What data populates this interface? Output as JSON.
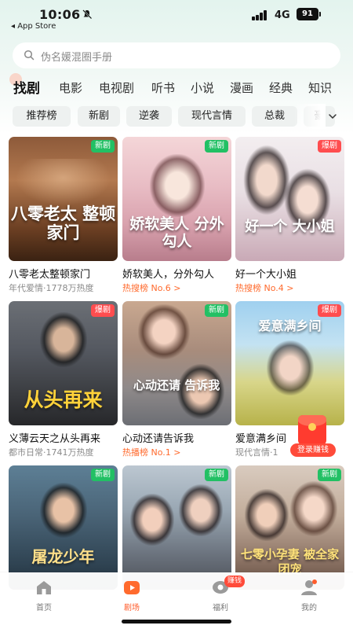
{
  "status_bar": {
    "time": "10:06",
    "back_app": "◂ App Store",
    "network": "4G",
    "battery": "91"
  },
  "search": {
    "placeholder": "伪名媛混圈手册"
  },
  "categories": [
    {
      "label": "找剧"
    },
    {
      "label": "电影"
    },
    {
      "label": "电视剧"
    },
    {
      "label": "听书"
    },
    {
      "label": "小说"
    },
    {
      "label": "漫画"
    },
    {
      "label": "经典"
    },
    {
      "label": "知识"
    }
  ],
  "chips": [
    {
      "label": "推荐榜"
    },
    {
      "label": "新剧"
    },
    {
      "label": "逆袭"
    },
    {
      "label": "现代言情"
    },
    {
      "label": "总裁"
    },
    {
      "label": "豪"
    }
  ],
  "cards": [
    {
      "title": "八零老太整顿家门",
      "sub": "年代爱情·1778万热度",
      "badge": "新剧",
      "poster_text": "八零老太 整顿家门"
    },
    {
      "title": "娇软美人，分外勾人",
      "sub": "热搜榜 No.6 >",
      "badge": "新剧",
      "poster_text": "娇软美人 分外勾人"
    },
    {
      "title": "好一个大小姐",
      "sub": "热搜榜 No.4 >",
      "badge": "爆剧",
      "poster_text": "好一个 大小姐"
    },
    {
      "title": "义薄云天之从头再来",
      "sub": "都市日常·1741万热度",
      "badge": "爆剧",
      "poster_text": "从头再来"
    },
    {
      "title": "心动还请告诉我",
      "sub": "热播榜 No.1 >",
      "badge": "新剧",
      "poster_text": "心动还请 告诉我"
    },
    {
      "title": "爱意满乡间",
      "sub": "现代言情·1",
      "badge": "爆剧",
      "poster_text": "爱意满乡间"
    },
    {
      "title": "",
      "sub": "",
      "badge": "新剧",
      "poster_text": "屠龙少年"
    },
    {
      "title": "",
      "sub": "",
      "badge": "新剧",
      "poster_text": ""
    },
    {
      "title": "",
      "sub": "",
      "badge": "新剧",
      "poster_text": "七零小孕妻 被全家团宠"
    }
  ],
  "bonus": {
    "label": "登录赚钱"
  },
  "bottom_nav": [
    {
      "label": "首页"
    },
    {
      "label": "剧场"
    },
    {
      "label": "福利"
    },
    {
      "label": "我的"
    }
  ],
  "welfare_badge": "赚钱",
  "colors": {
    "accent": "#ff5c2b",
    "badge_new": "#22c064",
    "badge_hot": "#ff4d4f",
    "header_bg": "#e3f4ee"
  }
}
